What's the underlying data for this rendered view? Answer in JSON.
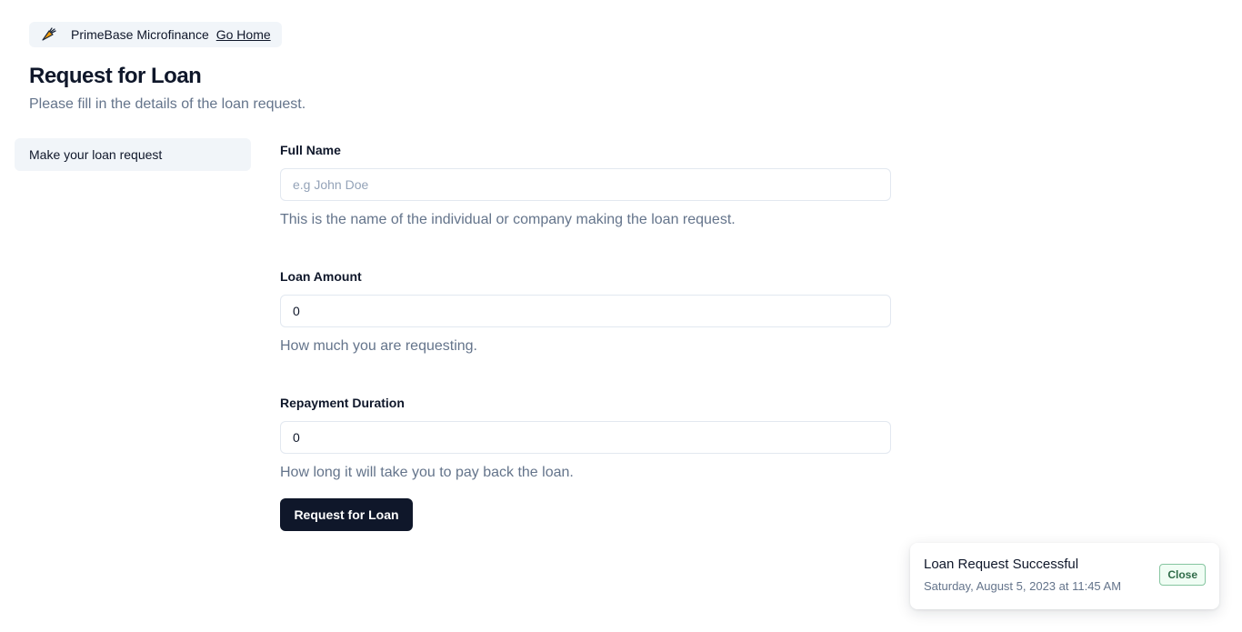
{
  "header": {
    "icon": "carrot-icon",
    "brand_name": "PrimeBase Microfinance",
    "go_home_label": "Go Home"
  },
  "page": {
    "title": "Request for Loan",
    "subtitle": "Please fill in the details of the loan request."
  },
  "sidebar": {
    "items": [
      {
        "label": "Make your loan request"
      }
    ]
  },
  "form": {
    "full_name": {
      "label": "Full Name",
      "placeholder": "e.g John Doe",
      "value": "",
      "help": "This is the name of the individual or company making the loan request."
    },
    "loan_amount": {
      "label": "Loan Amount",
      "value": "0",
      "help": "How much you are requesting."
    },
    "repayment_duration": {
      "label": "Repayment Duration",
      "value": "0",
      "help": "How long it will take you to pay back the loan."
    },
    "submit_label": "Request for Loan"
  },
  "toast": {
    "title": "Loan Request Successful",
    "timestamp": "Saturday, August 5, 2023 at 11:45 AM",
    "close_label": "Close"
  },
  "colors": {
    "primary": "#0f172a",
    "muted_text": "#64748b",
    "surface": "#f1f5f9",
    "success_border": "#86c5a0"
  }
}
